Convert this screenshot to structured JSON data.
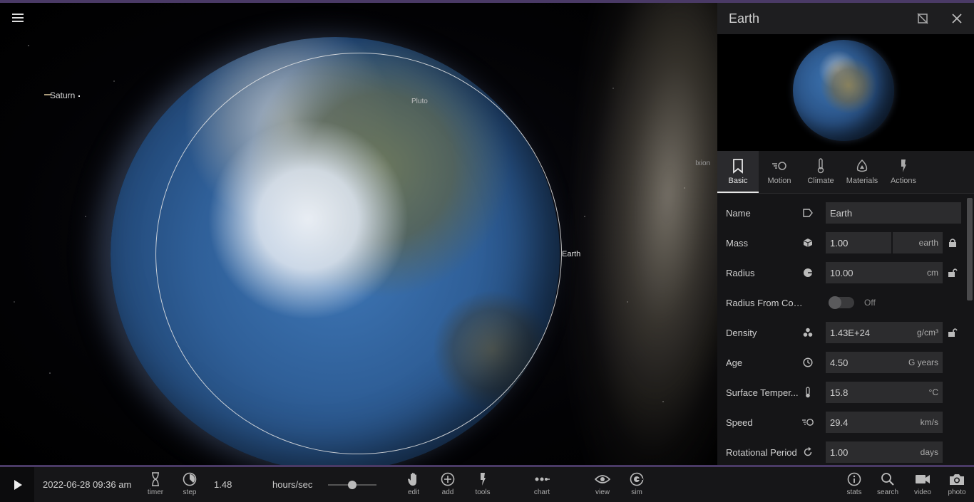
{
  "space": {
    "labels": {
      "saturn": "Saturn",
      "pluto": "Pluto",
      "earth": "Earth",
      "ixion": "Ixion"
    }
  },
  "panel": {
    "title": "Earth",
    "tabs": [
      {
        "label": "Basic",
        "icon": "bookmark-icon",
        "active": true
      },
      {
        "label": "Motion",
        "icon": "motion-icon"
      },
      {
        "label": "Climate",
        "icon": "thermometer-icon"
      },
      {
        "label": "Materials",
        "icon": "materials-icon"
      },
      {
        "label": "Actions",
        "icon": "actions-icon"
      }
    ],
    "properties": {
      "name": {
        "label": "Name",
        "value": "Earth"
      },
      "mass": {
        "label": "Mass",
        "value": "1.00",
        "unit": "earth"
      },
      "radius": {
        "label": "Radius",
        "value": "10.00",
        "unit": "cm"
      },
      "radius_from_composition": {
        "label": "Radius From Composi...",
        "state": "Off"
      },
      "density": {
        "label": "Density",
        "value": "1.43E+24",
        "unit": "g/cm³"
      },
      "age": {
        "label": "Age",
        "value": "4.50",
        "unit": "G years"
      },
      "surface_temperature": {
        "label": "Surface Temper...",
        "value": "15.8",
        "unit": "°C"
      },
      "speed": {
        "label": "Speed",
        "value": "29.4",
        "unit": "km/s"
      },
      "rotational_period": {
        "label": "Rotational Period",
        "value": "1.00",
        "unit": "days"
      }
    }
  },
  "toolbar": {
    "datetime": "2022-06-28 09:36 am",
    "timer": "timer",
    "step": "step",
    "rate": "1.48",
    "rate_unit": "hours/sec",
    "rate_slider_fraction": 0.5,
    "edit": "edit",
    "add": "add",
    "tools": "tools",
    "chart": "chart",
    "view": "view",
    "sim": "sim",
    "stats": "stats",
    "search": "search",
    "video": "video",
    "photo": "photo"
  },
  "colors": {
    "accent": "#4a3a66",
    "panel_bg": "#161618",
    "field_bg": "#2c2c2e"
  }
}
